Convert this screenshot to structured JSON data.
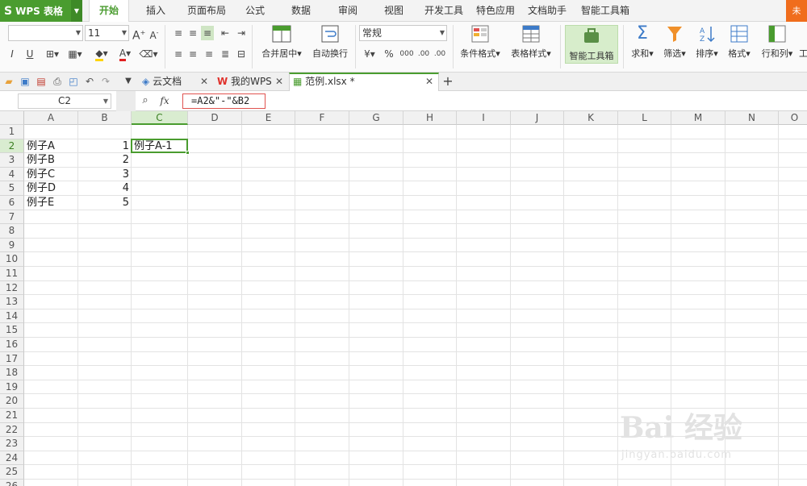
{
  "app": {
    "logo": "S",
    "title": "WPS 表格"
  },
  "menu_tabs": [
    "开始",
    "插入",
    "页面布局",
    "公式",
    "数据",
    "审阅",
    "视图",
    "开发工具",
    "特色应用",
    "文档助手",
    "智能工具箱"
  ],
  "active_menu_tab": "开始",
  "corner_label": "未",
  "ribbon": {
    "font_name": "",
    "font_size": "11",
    "number_format": "常规",
    "merge_center": "合并居中",
    "wrap_text": "自动换行",
    "conditional_format": "条件格式",
    "table_style": "表格样式",
    "smart_toolbox": "智能工具箱",
    "sum": "求和",
    "filter": "筛选",
    "sort": "排序",
    "format": "格式",
    "row_col": "行和列",
    "work": "工",
    "percent": "%",
    "comma": "000",
    "inc_decimal": ".00",
    "dec_decimal": ".00",
    "currency": "¥"
  },
  "doc_tabs": [
    {
      "label": "云文档"
    },
    {
      "label": "我的WPS"
    },
    {
      "label": "范例.xlsx *"
    }
  ],
  "formula_bar": {
    "name_box": "C2",
    "fx": "fx",
    "formula": "=A2&\"-\"&B2"
  },
  "columns": [
    "A",
    "B",
    "C",
    "D",
    "E",
    "F",
    "G",
    "H",
    "I",
    "J",
    "K",
    "L",
    "M",
    "N",
    "O"
  ],
  "rows": [
    "1",
    "2",
    "3",
    "4",
    "5",
    "6",
    "7",
    "8",
    "9",
    "10",
    "11",
    "12",
    "13",
    "14",
    "15",
    "16",
    "17",
    "18",
    "19",
    "20",
    "21",
    "22",
    "23",
    "24",
    "25",
    "26"
  ],
  "selected_cell": "C2",
  "cells": {
    "A2": "例子A",
    "A3": "例子B",
    "A4": "例子C",
    "A5": "例子D",
    "A6": "例子E",
    "B2": "1",
    "B3": "2",
    "B4": "3",
    "B5": "4",
    "B6": "5",
    "C2": "例子A-1"
  },
  "watermark": {
    "brand": "Bai 经验",
    "url": "jingyan.baidu.com"
  }
}
